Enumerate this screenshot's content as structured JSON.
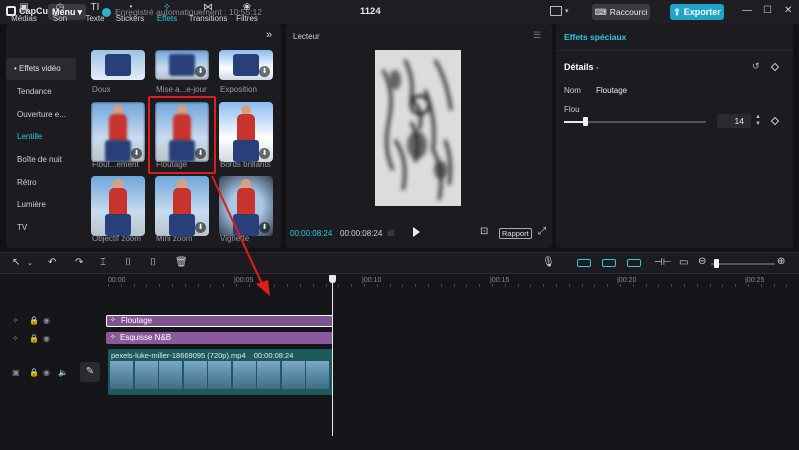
{
  "titlebar": {
    "app_name": "CapCut",
    "menu_label": "Menu",
    "autosave": "Enregistré automatiquement : 10:55:12",
    "project_title": "1124",
    "shortcuts_label": "Raccourci",
    "export_label": "Exporter"
  },
  "tool_tabs": [
    {
      "label": "Médias",
      "icon": "media-icon"
    },
    {
      "label": "Son",
      "icon": "audio-icon"
    },
    {
      "label": "Texte",
      "icon": "text-icon"
    },
    {
      "label": "Stickers",
      "icon": "sticker-icon"
    },
    {
      "label": "Effets",
      "icon": "effects-icon",
      "active": true
    },
    {
      "label": "Transitions",
      "icon": "transition-icon"
    },
    {
      "label": "Filtres",
      "icon": "filter-icon"
    }
  ],
  "categories": [
    {
      "label": "• Effets vidéo"
    },
    {
      "label": "Tendance"
    },
    {
      "label": "Ouverture e..."
    },
    {
      "label": "Lentille",
      "active": true
    },
    {
      "label": "Boîte de nuit"
    },
    {
      "label": "Rétro"
    },
    {
      "label": "Lumière"
    },
    {
      "label": "TV"
    }
  ],
  "effects": [
    {
      "label": "Doux"
    },
    {
      "label": "Mise a...e-jour"
    },
    {
      "label": "Exposition"
    },
    {
      "label": "Flout...ement"
    },
    {
      "label": "Floutage"
    },
    {
      "label": "Bords brillants"
    },
    {
      "label": "Objectif zoom"
    },
    {
      "label": "Mini zoom"
    },
    {
      "label": "Vignette"
    }
  ],
  "player": {
    "title": "Lecteur",
    "current_time": "00:00:08:24",
    "total_time": "00:00:08:24",
    "ratio_label": "Rapport"
  },
  "details": {
    "panel_title": "Effets spéciaux",
    "section_title": "Détails",
    "name_label": "Nom",
    "name_value": "Floutage",
    "blur_label": "Flou",
    "blur_value": "14",
    "blur_percent": 14
  },
  "timeline": {
    "ruler": [
      "00:00",
      "|00:05",
      "|00:10",
      "|00:15",
      "|00:20",
      "|00:25"
    ],
    "clip_effect_1": "Floutage",
    "clip_effect_2": "Esquisse N&B",
    "video_name": "pexels-luke-miller-18669095 (720p).mp4",
    "video_duration": "00:00:08:24"
  },
  "colors": {
    "accent": "#2ec9e0",
    "export": "#1fa3c7",
    "highlight": "#e11c1c",
    "effect_clip": "#8a5a9c",
    "video_clip": "#1d5a5a"
  }
}
